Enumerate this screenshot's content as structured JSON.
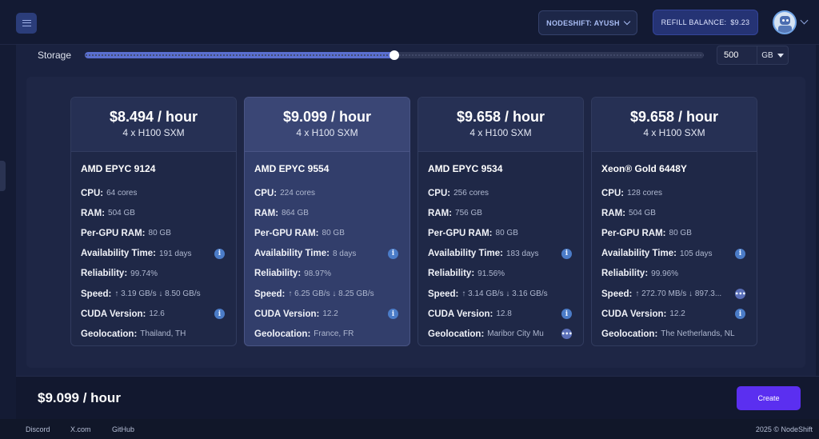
{
  "header": {
    "org_label": "NODESHIFT: AYUSH",
    "refill_label": "REFILL BALANCE:",
    "balance": "$9.23"
  },
  "storage": {
    "label": "Storage",
    "value": "500",
    "unit": "GB",
    "slider_fraction": 0.5
  },
  "cards": [
    {
      "price": "$8.494 / hour",
      "gpu": "4 x H100 SXM",
      "cpu_name": "AMD EPYC 9124",
      "cpu": "64 cores",
      "ram": "504 GB",
      "per_gpu_ram": "80 GB",
      "availability": "191 days",
      "reliability": "99.74%",
      "speed": "↑ 3.19 GB/s ↓ 8.50 GB/s",
      "cuda": "12.6",
      "geolocation": "Thailand, TH",
      "selected": false
    },
    {
      "price": "$9.099 / hour",
      "gpu": "4 x H100 SXM",
      "cpu_name": "AMD EPYC 9554",
      "cpu": "224 cores",
      "ram": "864 GB",
      "per_gpu_ram": "80 GB",
      "availability": "8 days",
      "reliability": "98.97%",
      "speed": "↑ 6.25 GB/s ↓ 8.25 GB/s",
      "cuda": "12.2",
      "geolocation": "France, FR",
      "selected": true
    },
    {
      "price": "$9.658 / hour",
      "gpu": "4 x H100 SXM",
      "cpu_name": "AMD EPYC 9534",
      "cpu": "256 cores",
      "ram": "756 GB",
      "per_gpu_ram": "80 GB",
      "availability": "183 days",
      "reliability": "91.56%",
      "speed": "↑ 3.14 GB/s ↓ 3.16 GB/s",
      "cuda": "12.8",
      "geolocation": "Maribor City Mu",
      "selected": false
    },
    {
      "price": "$9.658 / hour",
      "gpu": "4 x H100 SXM",
      "cpu_name": "Xeon® Gold 6448Y",
      "cpu": "128 cores",
      "ram": "504 GB",
      "per_gpu_ram": "80 GB",
      "availability": "105 days",
      "reliability": "99.96%",
      "speed": "↑ 272.70 MB/s ↓ 897.3...",
      "cuda": "12.2",
      "geolocation": "The Netherlands, NL",
      "selected": false
    }
  ],
  "labels": {
    "cpu": "CPU:",
    "ram": "RAM:",
    "per_gpu_ram": "Per-GPU RAM:",
    "availability": "Availability Time:",
    "reliability": "Reliability:",
    "speed": "Speed:",
    "cuda": "CUDA Version:",
    "geolocation": "Geolocation:"
  },
  "footer": {
    "total_price": "$9.099 / hour",
    "create_label": "Create"
  },
  "bottom_links": [
    "Discord",
    "X.com",
    "GitHub"
  ],
  "copyright": "2025 © NodeShift",
  "colors": {
    "accent": "#5b2ff0",
    "slider_fill": "#5a6fd0",
    "info_icon": "#4b7cc8"
  }
}
